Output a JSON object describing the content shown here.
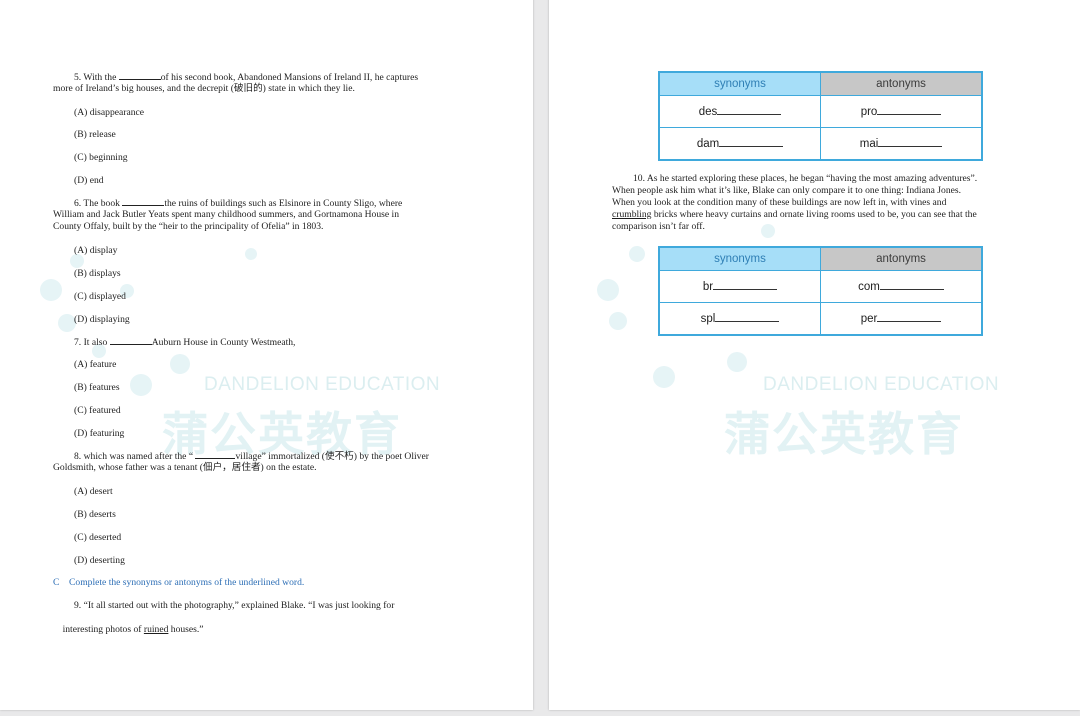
{
  "left_page": {
    "watermark": {
      "en": "DANDELION EDUCATION",
      "cn": "蒲公英教育"
    },
    "q5": {
      "text_a": "5. With the ",
      "text_b": "of his second book, Abandoned Mansions of Ireland II, he captures",
      "line2": "more of Ireland’s big houses, and the decrepit (破旧的) state in which they lie.",
      "options": [
        "(A) disappearance",
        "(B) release",
        "(C) beginning",
        "(D) end"
      ]
    },
    "q6": {
      "text_a": "6. The book ",
      "text_b": "the ruins of buildings such as Elsinore in County Sligo, where",
      "line2": "William and Jack Butler Yeats spent many childhood summers, and Gortnamona House in",
      "line3": "County Offaly, built by the “heir to the principality of Ofelia” in 1803.",
      "options": [
        "(A) display",
        "(B) displays",
        "(C) displayed",
        "(D) displaying"
      ]
    },
    "q7": {
      "text_a": "7. It also ",
      "text_b": "Auburn House in County Westmeath,",
      "options": [
        "(A) feature",
        "(B) features",
        "(C) featured",
        "(D) featuring"
      ]
    },
    "q8": {
      "text_a": "8. which was named after the “ ",
      "text_b": "village” immortalized (使不朽) by the poet Oliver",
      "line2": "Goldsmith, whose father was a tenant (佃户，居住者) on the estate.",
      "options": [
        "(A) desert",
        "(B) deserts",
        "(C) deserted",
        "(D) deserting"
      ]
    },
    "section_c": "C    Complete the synonyms or antonyms of the underlined word.",
    "q9": {
      "line1": "9. “It all started out with the photography,” explained Blake. “I was just looking for",
      "line2_a": "interesting photos of ",
      "line2_u": "ruined",
      "line2_b": " houses.”"
    }
  },
  "right_page": {
    "watermark": {
      "en": "DANDELION EDUCATION",
      "cn": "蒲公英教育"
    },
    "table1": {
      "headers": [
        "synonyms",
        "antonyms"
      ],
      "rows": [
        [
          "des",
          "pro"
        ],
        [
          "dam",
          "mai"
        ]
      ]
    },
    "q10": {
      "line1": "10. As he started exploring these places, he began “having the most amazing adventures”.",
      "line2": "When people ask him what it’s like, Blake can only compare it to one thing: Indiana Jones.",
      "line3": "When you look at the condition many of these buildings are now left in, with vines and",
      "line4_u": "crumbling",
      "line4_b": " bricks where heavy curtains and ornate living rooms used to be, you can see that the",
      "line5": "comparison isn’t far off."
    },
    "table2": {
      "headers": [
        "synonyms",
        "antonyms"
      ],
      "rows": [
        [
          "br",
          "com"
        ],
        [
          "spl",
          "per"
        ]
      ]
    }
  },
  "colors": {
    "accent_blue": "#3fa9dc",
    "header_blue": "#a6def8",
    "header_gray": "#c7c7c7",
    "section_blue": "#2e6fb6"
  }
}
